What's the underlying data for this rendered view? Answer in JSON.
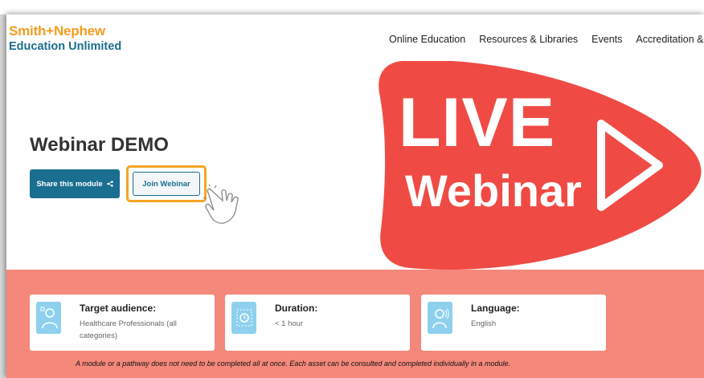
{
  "brand": {
    "line1": "Smith+Nephew",
    "line2": "Education Unlimited"
  },
  "nav": {
    "items": [
      "Online Education",
      "Resources & Libraries",
      "Events",
      "Accreditation & CME"
    ]
  },
  "hero": {
    "title": "Webinar DEMO",
    "share_label": "Share this module",
    "join_label": "Join Webinar",
    "banner_live": "LIVE",
    "banner_webinar": "Webinar"
  },
  "info": {
    "audience": {
      "title": "Target audience:",
      "value": "Healthcare Professionals (all categories)"
    },
    "duration": {
      "title": "Duration:",
      "value": "< 1 hour"
    },
    "language": {
      "title": "Language:",
      "value": "English"
    }
  },
  "note": "A module or a pathway does not need to be completed all at once. Each asset can be consulted and completed individually in a module.",
  "colors": {
    "brand_orange": "#f39c1f",
    "brand_teal": "#1a6e8f",
    "live_red": "#ef4b44",
    "band_salmon": "#f4887b",
    "highlight": "#f5a623"
  }
}
